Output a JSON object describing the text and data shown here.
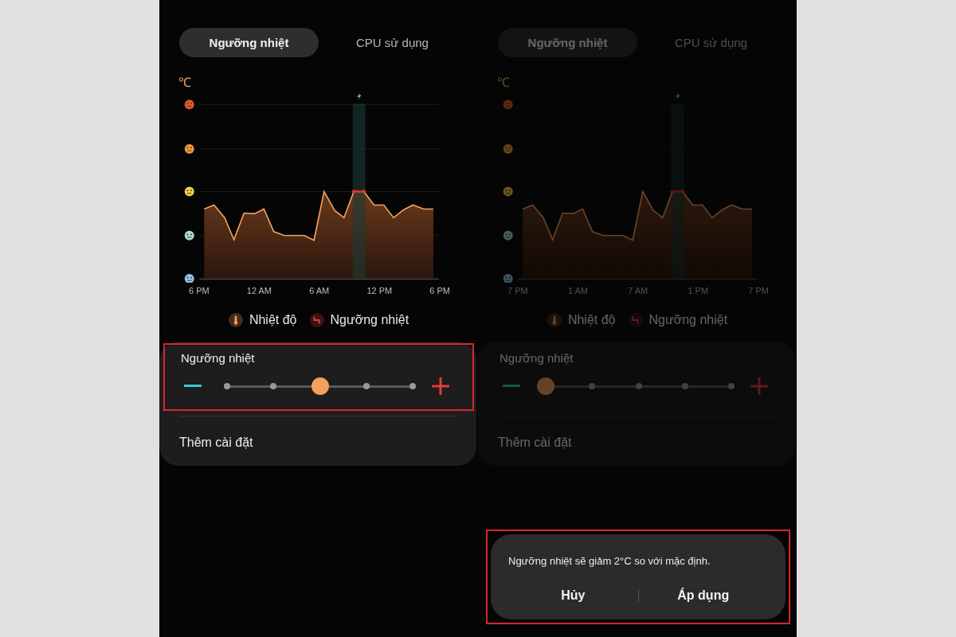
{
  "screens": [
    {
      "dimmed": false,
      "tabs": [
        {
          "label": "Ngưỡng nhiệt",
          "selected": true
        },
        {
          "label": "CPU sử dụng",
          "selected": false
        }
      ],
      "unit": "℃",
      "x_labels": [
        "6 PM",
        "12 AM",
        "6 AM",
        "12 PM",
        "6 PM"
      ],
      "legend": [
        {
          "kind": "temperature",
          "label": "Nhiệt độ"
        },
        {
          "kind": "threshold",
          "label": "Ngưỡng nhiệt"
        }
      ],
      "threshold": {
        "label": "Ngưỡng nhiệt",
        "level": 0.5,
        "highlighted": true
      },
      "more_settings": "Thêm cài đặt"
    },
    {
      "dimmed": true,
      "tabs": [
        {
          "label": "Ngưỡng nhiệt",
          "selected": true
        },
        {
          "label": "CPU sử dụng",
          "selected": false
        }
      ],
      "unit": "℃",
      "x_labels": [
        "7 PM",
        "1 AM",
        "7 AM",
        "1 PM",
        "7 PM"
      ],
      "legend": [
        {
          "kind": "temperature",
          "label": "Nhiệt độ"
        },
        {
          "kind": "threshold",
          "label": "Ngưỡng nhiệt"
        }
      ],
      "threshold": {
        "label": "Ngưỡng nhiệt",
        "level": 0,
        "highlighted": false
      },
      "more_settings": "Thêm cài đặt",
      "dialog": {
        "message": "Ngưỡng nhiệt sẽ giảm 2°C so với mặc định.",
        "buttons": [
          "Hủy",
          "Áp dụng"
        ],
        "highlighted": true
      }
    }
  ]
}
